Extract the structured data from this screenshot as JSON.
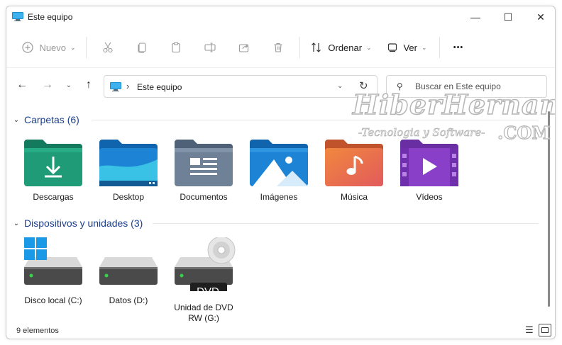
{
  "window": {
    "title": "Este equipo",
    "minimize": "—",
    "maximize": "☐",
    "close": "✕"
  },
  "toolbar": {
    "new_label": "Nuevo",
    "sort_label": "Ordenar",
    "view_label": "Ver",
    "more_label": "•••"
  },
  "address": {
    "path": "Este equipo",
    "separator": "›"
  },
  "search": {
    "placeholder": "Buscar en Este equipo"
  },
  "folders_section": {
    "title": "Carpetas (6)",
    "items": [
      {
        "label": "Descargas",
        "icon": "downloads-folder-icon"
      },
      {
        "label": "Desktop",
        "icon": "desktop-folder-icon"
      },
      {
        "label": "Documentos",
        "icon": "documents-folder-icon"
      },
      {
        "label": "Imágenes",
        "icon": "pictures-folder-icon"
      },
      {
        "label": "Música",
        "icon": "music-folder-icon"
      },
      {
        "label": "Vídeos",
        "icon": "videos-folder-icon"
      }
    ]
  },
  "drives_section": {
    "title": "Dispositivos y unidades (3)",
    "items": [
      {
        "label": "Disco local (C:)",
        "icon": "windows-drive-icon"
      },
      {
        "label": "Datos (D:)",
        "icon": "drive-icon"
      },
      {
        "label_line1": "Unidad de DVD",
        "label_line2": "RW (G:)",
        "badge": "DVD",
        "icon": "dvd-drive-icon"
      }
    ]
  },
  "status": {
    "count": "9 elementos"
  },
  "watermark": {
    "main": "HiberHernandez",
    "sub": "-Tecnologia y Software-",
    "com": ".COM"
  },
  "colors": {
    "accent": "#1b3f8f",
    "folder_green": "#1f9b77",
    "folder_blue": "#1d83d4",
    "folder_gray": "#6f8196",
    "folder_orange": "#e4743b",
    "folder_purple": "#8a3fc9"
  }
}
